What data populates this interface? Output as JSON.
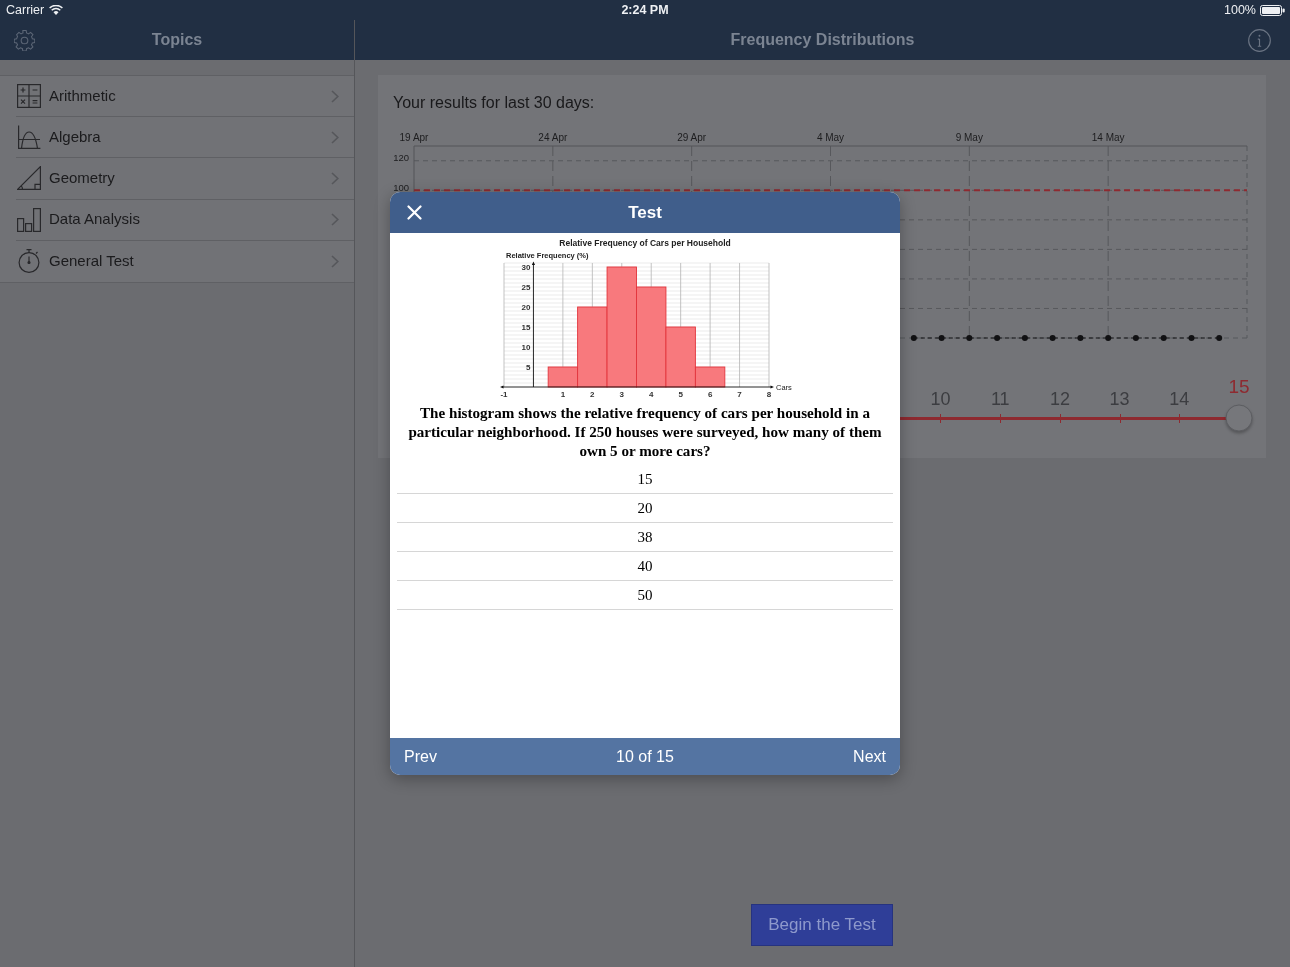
{
  "status_bar": {
    "carrier": "Carrier",
    "time": "2:24 PM",
    "battery": "100%"
  },
  "sidebar": {
    "title": "Topics",
    "items": [
      {
        "label": "Arithmetic",
        "selected": false
      },
      {
        "label": "Algebra",
        "selected": false
      },
      {
        "label": "Geometry",
        "selected": false
      },
      {
        "label": "Data Analysis",
        "selected": false
      },
      {
        "label": "General Test",
        "selected": false
      }
    ]
  },
  "main": {
    "title": "Frequency Distributions",
    "results": {
      "heading": "Your results for last 30 days:",
      "chart_data": [
        {
          "type": "line",
          "x": [
            "--05-07",
            "--05-08",
            "--05-09",
            "--05-10",
            "--05-11",
            "--05-12",
            "--05-13",
            "--05-14",
            "--05-15",
            "--05-16",
            "--05-17",
            "--05-18"
          ],
          "values": [
            0,
            0,
            0,
            0,
            0,
            0,
            0,
            0,
            0,
            0,
            0,
            0
          ],
          "color": "#111113",
          "marker": "circle",
          "line_style": "dashed",
          "xlim": [
            "--04-19",
            "--05-19"
          ],
          "ylim": [
            0,
            130
          ],
          "xticks": [
            {
              "value": "--04-19",
              "label": "19 Apr"
            },
            {
              "value": "--04-24",
              "label": "24 Apr"
            },
            {
              "value": "--04-29",
              "label": "29 Apr"
            },
            {
              "value": "--05-04",
              "label": "4 May"
            },
            {
              "value": "--05-09",
              "label": "9 May"
            },
            {
              "value": "--05-14",
              "label": "14 May"
            }
          ],
          "yticks": [
            100,
            120
          ],
          "grid": true,
          "ref_lines": [
            {
              "axis": "y",
              "value": 100,
              "color": "#8e2a30",
              "line_style": "dashed"
            }
          ]
        }
      ]
    },
    "slider": {
      "labels": [
        {
          "text": "10",
          "selected": false
        },
        {
          "text": "11",
          "selected": false
        },
        {
          "text": "12",
          "selected": false
        },
        {
          "text": "13",
          "selected": false
        },
        {
          "text": "14",
          "selected": false
        },
        {
          "text": "15",
          "selected": true
        }
      ],
      "level": 1
    },
    "begin_button": "Begin the Test"
  },
  "modal": {
    "title": "Test",
    "figure": {
      "chart_data": [
        {
          "type": "histogram",
          "title": "Relative Frequency of Cars per Household",
          "xlabel": "Cars",
          "ylabel": "Relative Frequency (%)",
          "bins": [
            0.5,
            1.5,
            2.5,
            3.5,
            4.5,
            5.5,
            6.5
          ],
          "values": [
            5,
            20,
            30,
            25,
            15,
            5
          ],
          "color": "#f8797d",
          "xlim": [
            -1,
            8
          ],
          "ylim": [
            0,
            30
          ],
          "xticks": [
            -1,
            1,
            2,
            3,
            4,
            5,
            6,
            7,
            8
          ],
          "yticks": [
            5,
            10,
            15,
            20,
            25,
            30
          ],
          "grid": true
        }
      ]
    },
    "question": "The histogram shows the relative frequency of cars per household in a particular neighborhood. If 250 houses were surveyed, how many of them own 5 or more cars?",
    "answers": [
      {
        "text": "15",
        "selected": false
      },
      {
        "text": "20",
        "selected": false
      },
      {
        "text": "38",
        "selected": false
      },
      {
        "text": "40",
        "selected": false
      },
      {
        "text": "50",
        "selected": false
      }
    ],
    "footer": {
      "prev": "Prev",
      "position": "10 of 15",
      "next": "Next"
    }
  }
}
